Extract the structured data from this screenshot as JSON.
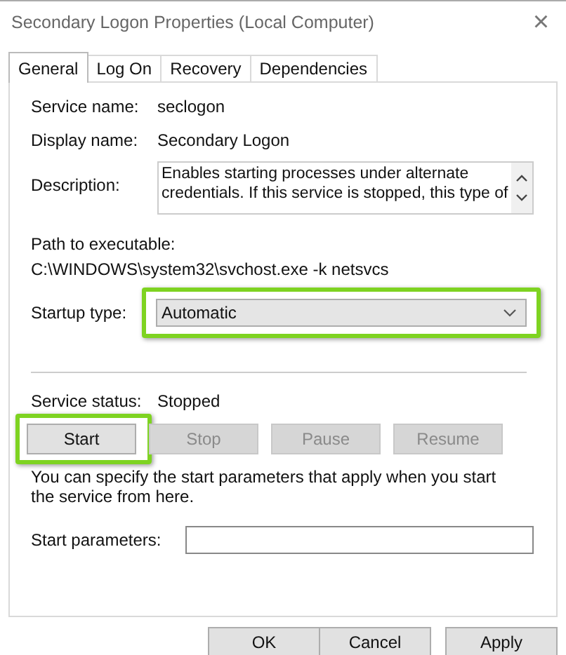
{
  "window": {
    "title": "Secondary Logon Properties (Local Computer)",
    "close": "×"
  },
  "tabs": [
    {
      "label": "General",
      "selected": true
    },
    {
      "label": "Log On",
      "selected": false
    },
    {
      "label": "Recovery",
      "selected": false
    },
    {
      "label": "Dependencies",
      "selected": false
    }
  ],
  "service_name": {
    "label": "Service name:",
    "value": "seclogon"
  },
  "display_name": {
    "label": "Display name:",
    "value": "Secondary Logon"
  },
  "description": {
    "label": "Description:",
    "lines": [
      "Enables starting processes under alternate",
      "credentials. If this service is stopped, this type of"
    ]
  },
  "path": {
    "label": "Path to executable:",
    "value": "C:\\WINDOWS\\system32\\svchost.exe -k netsvcs"
  },
  "startup_type": {
    "label": "Startup type:",
    "value": "Automatic",
    "highlighted": true
  },
  "service_status": {
    "label": "Service status:",
    "value": "Stopped"
  },
  "service_buttons": [
    {
      "label": "Start",
      "disabled": false,
      "highlighted": true
    },
    {
      "label": "Stop",
      "disabled": true,
      "highlighted": false
    },
    {
      "label": "Pause",
      "disabled": true,
      "highlighted": false
    },
    {
      "label": "Resume",
      "disabled": true,
      "highlighted": false
    }
  ],
  "hint": "You can specify the start parameters that apply when you start the service from here.",
  "start_parameters": {
    "label": "Start parameters:"
  },
  "dialog_buttons": [
    "OK",
    "Cancel",
    "Apply"
  ]
}
